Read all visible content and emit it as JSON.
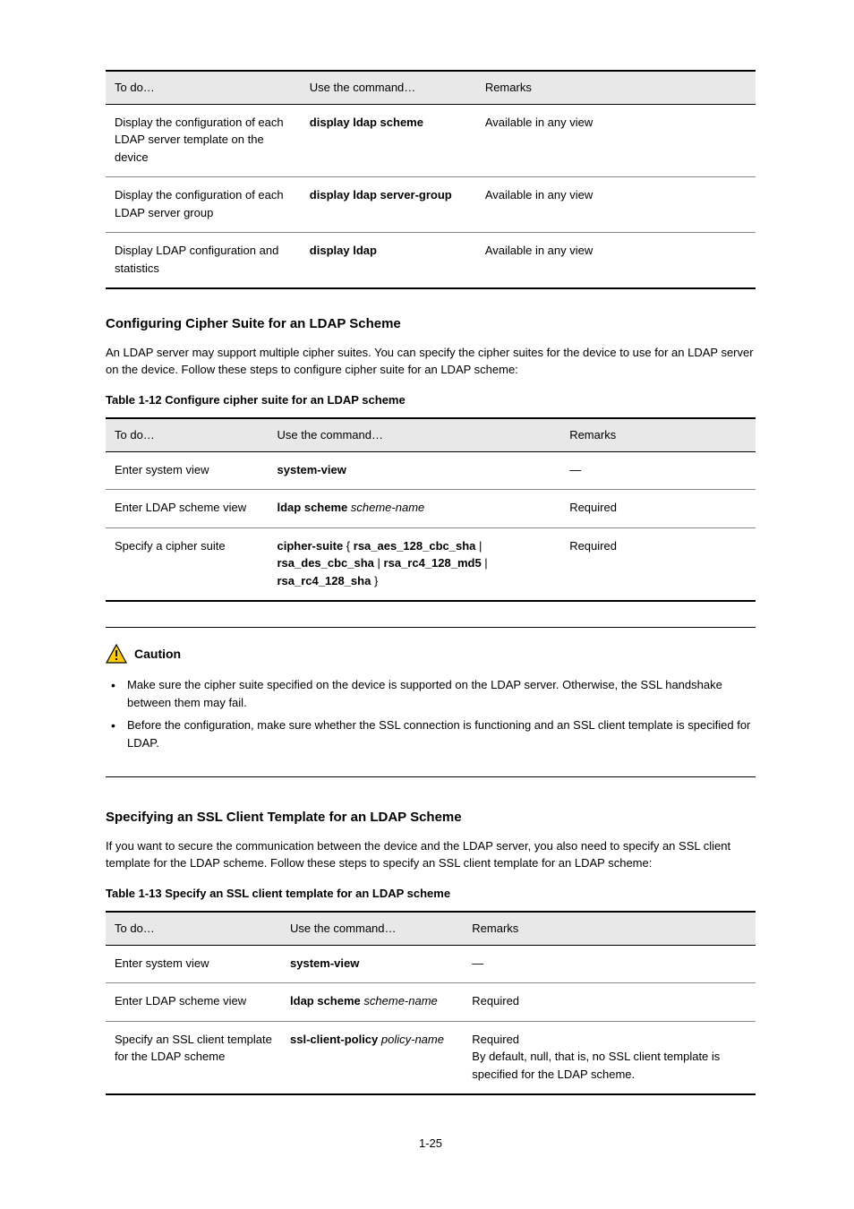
{
  "table1": {
    "headers": [
      "To do…",
      "Use the command…",
      "Remarks"
    ],
    "rows": [
      [
        "Display the configuration of each LDAP server template on the device",
        "display ldap scheme",
        "Available in any view"
      ],
      [
        "Display the configuration of each LDAP server group",
        "display ldap server-group",
        "Available in any view"
      ],
      [
        "Display LDAP configuration and statistics",
        "display ldap",
        "Available in any view"
      ]
    ]
  },
  "section_cipher": {
    "title": "Configuring Cipher Suite for an LDAP Scheme",
    "body": "An LDAP server may support multiple cipher suites. You can specify the cipher suites for the device to use for an LDAP server on the device. Follow these steps to configure cipher suite for an LDAP scheme:",
    "table_caption": "Table 1-12 Configure cipher suite for an LDAP scheme",
    "table": {
      "headers": [
        "To do…",
        "Use the command…",
        "Remarks"
      ],
      "rows": [
        [
          "Enter system view",
          "system-view",
          "—"
        ],
        [
          "Enter LDAP scheme view",
          "ldap scheme scheme-name",
          "Required"
        ],
        [
          "Specify a cipher suite",
          "cipher-suite { rsa_aes_128_cbc_sha | rsa_des_cbc_sha | rsa_rc4_128_md5 | rsa_rc4_128_sha }",
          "Required"
        ]
      ]
    }
  },
  "caution": {
    "label": "Caution",
    "items": [
      "Make sure the cipher suite specified on the device is supported on the LDAP server. Otherwise, the SSL handshake between them may fail.",
      "Before the configuration, make sure whether the SSL connection is functioning and an SSL client template is specified for LDAP."
    ]
  },
  "section_tmpl": {
    "title": "Specifying an SSL Client Template for an LDAP Scheme",
    "body": "If you want to secure the communication between the device and the LDAP server, you also need to specify an SSL client template for the LDAP scheme. Follow these steps to specify an SSL client template for an LDAP scheme:",
    "table_caption": "Table 1-13 Specify an SSL client template for an LDAP scheme",
    "table": {
      "headers": [
        "To do…",
        "Use the command…",
        "Remarks"
      ],
      "rows": [
        [
          "Enter system view",
          "system-view",
          "—"
        ],
        [
          "Enter LDAP scheme view",
          "ldap scheme scheme-name",
          "Required"
        ],
        [
          "Specify an SSL client template for the LDAP scheme",
          "ssl-client-policy policy-name",
          "Required\nBy default, null, that is, no SSL client template is specified for the LDAP scheme."
        ]
      ]
    }
  },
  "footer": "1-25"
}
